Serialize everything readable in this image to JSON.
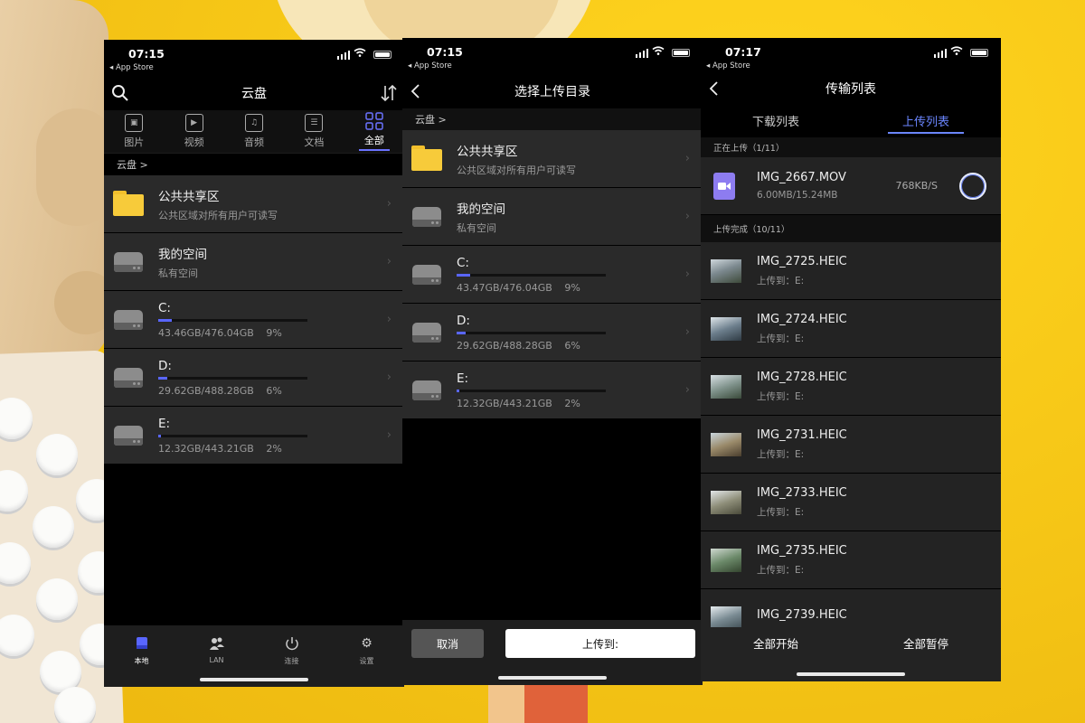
{
  "colors": {
    "background": "#f4c41a",
    "accent": "#5966ff",
    "folder": "#f7cb3a"
  },
  "phone1": {
    "status": {
      "time": "07:15",
      "back_app": "◂ App Store"
    },
    "nav": {
      "title": "云盘",
      "left_icon": "search-icon",
      "right_icon": "sort-icon"
    },
    "categories": [
      {
        "label": "图片",
        "icon": "image-icon"
      },
      {
        "label": "视频",
        "icon": "video-icon"
      },
      {
        "label": "音频",
        "icon": "music-icon"
      },
      {
        "label": "文档",
        "icon": "document-icon"
      },
      {
        "label": "全部",
        "icon": "grid-icon",
        "active": true
      }
    ],
    "breadcrumb": "云盘 >",
    "folders": [
      {
        "title": "公共共享区",
        "subtitle": "公共区域对所有用户可读写"
      },
      {
        "title": "我的空间",
        "subtitle": "私有空间"
      }
    ],
    "disks": [
      {
        "name": "C:",
        "usage": "43.46GB/476.04GB",
        "percent_label": "9%",
        "percent": 9
      },
      {
        "name": "D:",
        "usage": "29.62GB/488.28GB",
        "percent_label": "6%",
        "percent": 6
      },
      {
        "name": "E:",
        "usage": "12.32GB/443.21GB",
        "percent_label": "2%",
        "percent": 2
      }
    ],
    "tabbar": [
      {
        "label": "本地",
        "icon": "local-icon",
        "active": true
      },
      {
        "label": "LAN",
        "icon": "users-icon"
      },
      {
        "label": "连接",
        "icon": "power-icon"
      },
      {
        "label": "设置",
        "icon": "gear-icon"
      }
    ]
  },
  "phone2": {
    "status": {
      "time": "07:15",
      "back_app": "◂ App Store"
    },
    "nav": {
      "title": "选择上传目录",
      "left_icon": "back-icon"
    },
    "breadcrumb": "云盘 >",
    "folders": [
      {
        "title": "公共共享区",
        "subtitle": "公共区域对所有用户可读写"
      },
      {
        "title": "我的空间",
        "subtitle": "私有空间"
      }
    ],
    "disks": [
      {
        "name": "C:",
        "usage": "43.47GB/476.04GB",
        "percent_label": "9%",
        "percent": 9
      },
      {
        "name": "D:",
        "usage": "29.62GB/488.28GB",
        "percent_label": "6%",
        "percent": 6
      },
      {
        "name": "E:",
        "usage": "12.32GB/443.21GB",
        "percent_label": "2%",
        "percent": 2
      }
    ],
    "cancel_label": "取消",
    "upload_label": "上传到:"
  },
  "phone3": {
    "status": {
      "time": "07:17",
      "back_app": "◂ App Store"
    },
    "nav": {
      "title": "传输列表",
      "left_icon": "back-icon"
    },
    "tabs": [
      {
        "label": "下载列表"
      },
      {
        "label": "上传列表",
        "active": true
      }
    ],
    "uploading_header": "正在上传（1/11）",
    "uploading": {
      "name": "IMG_2667.MOV",
      "progress": "6.00MB/15.24MB",
      "speed": "768KB/S"
    },
    "done_header": "上传完成（10/11）",
    "done": [
      {
        "name": "IMG_2725.HEIC",
        "dest": "上传到：E:"
      },
      {
        "name": "IMG_2724.HEIC",
        "dest": "上传到：E:"
      },
      {
        "name": "IMG_2728.HEIC",
        "dest": "上传到：E:"
      },
      {
        "name": "IMG_2731.HEIC",
        "dest": "上传到：E:"
      },
      {
        "name": "IMG_2733.HEIC",
        "dest": "上传到：E:"
      },
      {
        "name": "IMG_2735.HEIC",
        "dest": "上传到：E:"
      },
      {
        "name": "IMG_2739.HEIC",
        "dest": ""
      }
    ],
    "start_all": "全部开始",
    "pause_all": "全部暂停"
  }
}
